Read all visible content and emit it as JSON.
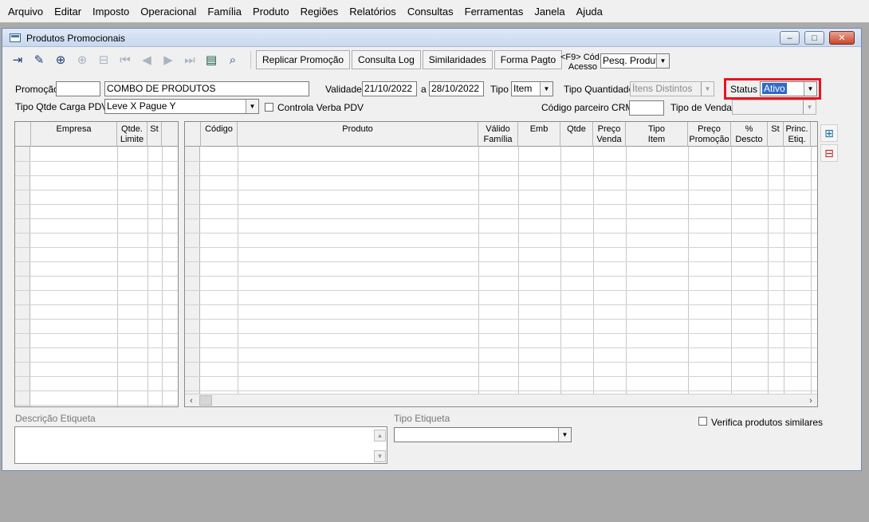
{
  "menu": [
    "Arquivo",
    "Editar",
    "Imposto",
    "Operacional",
    "Família",
    "Produto",
    "Regiões",
    "Relatórios",
    "Consultas",
    "Ferramentas",
    "Janela",
    "Ajuda"
  ],
  "window": {
    "title": "Produtos Promocionais",
    "minimize": "–",
    "maximize": "□",
    "close": "✕"
  },
  "toolbar": {
    "replicar": "Replicar Promoção",
    "consulta_log": "Consulta Log",
    "similaridades": "Similaridades",
    "forma_pagto": "Forma Pagto",
    "cod_acesso_label_1": "<F9> Cód",
    "cod_acesso_label_2": "Acesso",
    "cod_acesso_value": "Pesq. Produtc"
  },
  "form": {
    "promocao_label": "Promoção",
    "promocao_code": "",
    "promocao_desc": "COMBO DE PRODUTOS",
    "validade_label": "Validade",
    "validade_from": "21/10/2022",
    "validade_sep": "a",
    "validade_to": "28/10/2022",
    "tipo_label": "Tipo",
    "tipo_value": "Item",
    "tipo_quantidade_label": "Tipo Quantidade",
    "tipo_quantidade_value": "Ítens Distintos",
    "status_label": "Status",
    "status_value": "Ativo",
    "tipo_qtde_carga_label": "Tipo Qtde Carga PDV",
    "tipo_qtde_carga_value": "Leve X Pague Y",
    "controla_verba_label": "Controla Verba PDV",
    "codigo_parceiro_label": "Código parceiro CRM",
    "codigo_parceiro_value": "",
    "tipo_venda_label": "Tipo de Venda",
    "tipo_venda_value": ""
  },
  "grid_empresa": {
    "columns": [
      {
        "l1": "Empresa",
        "l2": ""
      },
      {
        "l1": "Qtde.",
        "l2": "Limite"
      },
      {
        "l1": "St",
        "l2": ""
      }
    ]
  },
  "grid_produto": {
    "columns": [
      {
        "l1": "Código",
        "l2": ""
      },
      {
        "l1": "Produto",
        "l2": ""
      },
      {
        "l1": "Válido",
        "l2": "Família"
      },
      {
        "l1": "Emb",
        "l2": ""
      },
      {
        "l1": "Qtde",
        "l2": ""
      },
      {
        "l1": "Preço",
        "l2": "Venda"
      },
      {
        "l1": "Tipo",
        "l2": "Item"
      },
      {
        "l1": "Preço",
        "l2": "Promoção"
      },
      {
        "l1": "%",
        "l2": "Descto"
      },
      {
        "l1": "St",
        "l2": ""
      },
      {
        "l1": "Princ.",
        "l2": "Etiq."
      }
    ]
  },
  "bottom": {
    "descricao_etiqueta_label": "Descrição Etiqueta",
    "descricao_etiqueta_value": "",
    "tipo_etiqueta_label": "Tipo Etiqueta",
    "tipo_etiqueta_value": "",
    "verifica_similares_label": "Verifica produtos similares"
  },
  "colors": {
    "highlight_border": "#e8141f",
    "selection_bg": "#316ac5"
  }
}
